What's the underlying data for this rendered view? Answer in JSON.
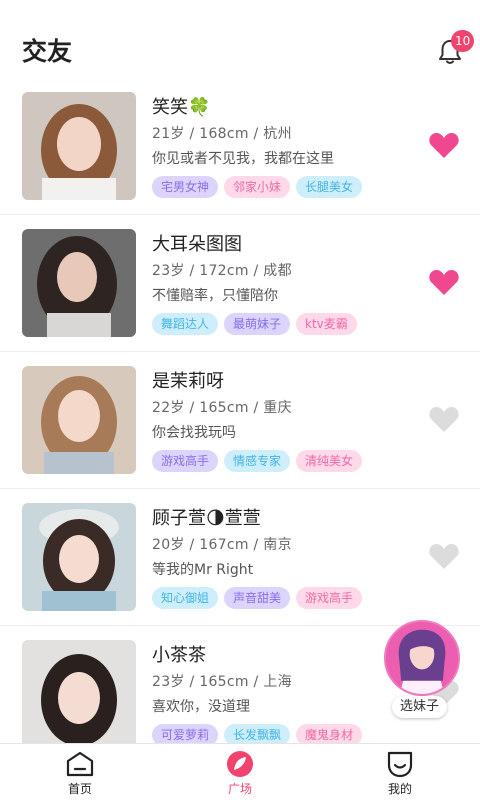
{
  "header": {
    "title": "交友",
    "notification_count": "10"
  },
  "cards": [
    {
      "name": "笑笑🍀",
      "meta": "21岁 / 168cm / 杭州",
      "bio": "你见或者不见我，我都在这里",
      "tags": [
        "宅男女神",
        "邻家小妹",
        "长腿美女"
      ],
      "liked": true
    },
    {
      "name": "大耳朵图图",
      "meta": "23岁 / 172cm / 成都",
      "bio": "不懂赔率，只懂陪你",
      "tags": [
        "舞蹈达人",
        "最萌妹子",
        "ktv麦霸"
      ],
      "liked": true
    },
    {
      "name": "是茉莉呀",
      "meta": "22岁 / 165cm / 重庆",
      "bio": "你会找我玩吗",
      "tags": [
        "游戏高手",
        "情感专家",
        "清纯美女"
      ],
      "liked": false
    },
    {
      "name": "顾子萱🌗萱萱",
      "meta": "20岁 / 167cm / 南京",
      "bio": "等我的Mr Right",
      "tags": [
        "知心御姐",
        "声音甜美",
        "游戏高手"
      ],
      "liked": false
    },
    {
      "name": "小茶茶",
      "meta": "23岁 / 165cm / 上海",
      "bio": "喜欢你，没道理",
      "tags": [
        "可爱萝莉",
        "长发飘飘",
        "魔鬼身材"
      ],
      "liked": false
    }
  ],
  "float_button": {
    "label": "选妹子"
  },
  "tabbar": {
    "items": [
      {
        "label": "首页",
        "icon": "home-icon"
      },
      {
        "label": "广场",
        "icon": "plaza-icon",
        "active": true
      },
      {
        "label": "我的",
        "icon": "profile-icon"
      }
    ]
  },
  "colors": {
    "accent": "#f0446d",
    "heart_active": "#f0488f",
    "heart_inactive": "#dcdcdc"
  }
}
